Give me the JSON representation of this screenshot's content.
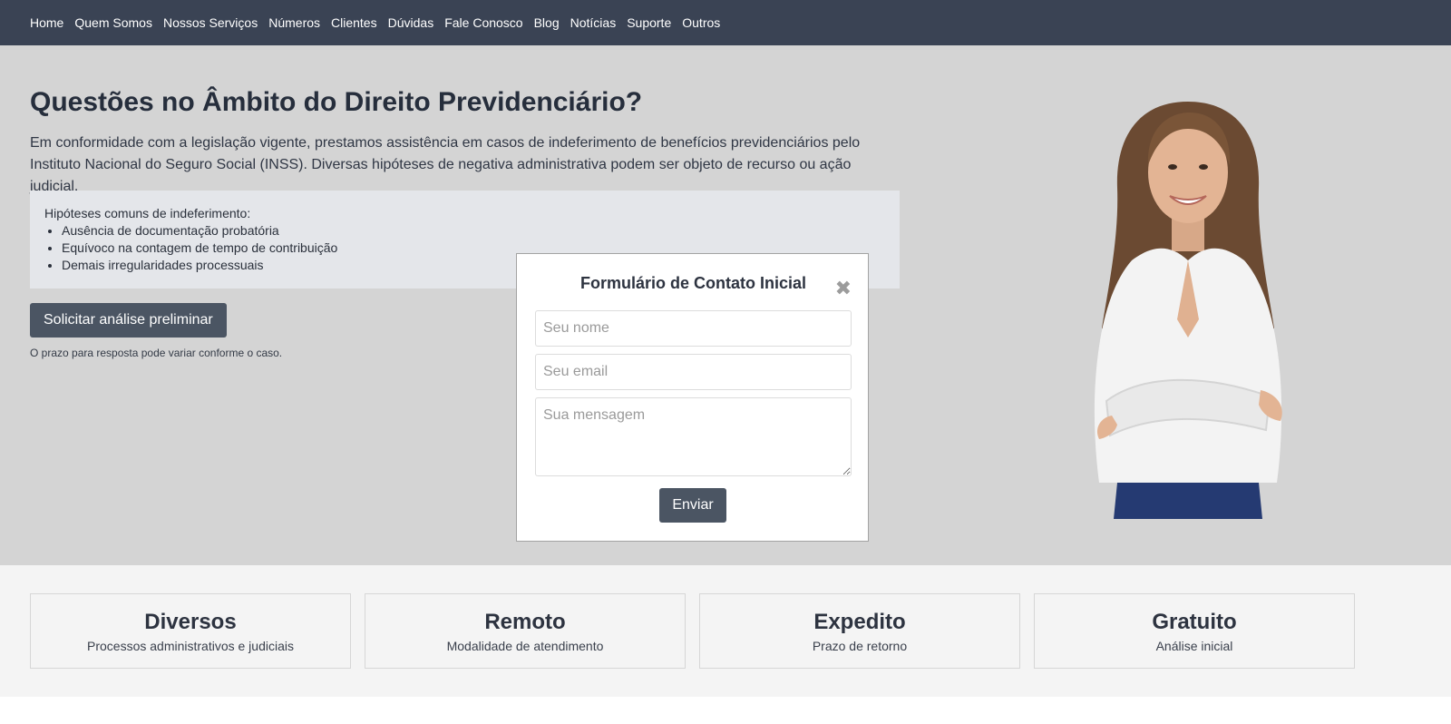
{
  "nav": {
    "items": [
      "Home",
      "Quem Somos",
      "Nossos Serviços",
      "Números",
      "Clientes",
      "Dúvidas",
      "Fale Conosco",
      "Blog",
      "Notícias",
      "Suporte",
      "Outros"
    ]
  },
  "hero": {
    "title": "Questões no Âmbito do Direito Previdenciário?",
    "intro": "Em conformidade com a legislação vigente, prestamos assistência em casos de indeferimento de benefícios previdenciários pelo Instituto Nacional do Seguro Social (INSS). Diversas hipóteses de negativa administrativa podem ser objeto de recurso ou ação judicial.",
    "reasons_heading": "Hipóteses comuns de indeferimento:",
    "reasons": [
      "Ausência de documentação probatória",
      "Equívoco na contagem de tempo de contribuição",
      "Demais irregularidades processuais"
    ],
    "cta_label": "Solicitar análise preliminar",
    "note": "O prazo para resposta pode variar conforme o caso."
  },
  "modal": {
    "title": "Formulário de Contato Inicial",
    "close_symbol": "✖",
    "name_placeholder": "Seu nome",
    "email_placeholder": "Seu email",
    "message_placeholder": "Sua mensagem",
    "submit_label": "Enviar"
  },
  "features": [
    {
      "title": "Diversos",
      "subtitle": "Processos administrativos e judiciais"
    },
    {
      "title": "Remoto",
      "subtitle": "Modalidade de atendimento"
    },
    {
      "title": "Expedito",
      "subtitle": "Prazo de retorno"
    },
    {
      "title": "Gratuito",
      "subtitle": "Análise inicial"
    }
  ],
  "colors": {
    "nav_bg": "#3a4354",
    "hero_bg": "#d4d4d4",
    "button_bg": "#4b5563",
    "features_bg": "#f4f4f4"
  }
}
